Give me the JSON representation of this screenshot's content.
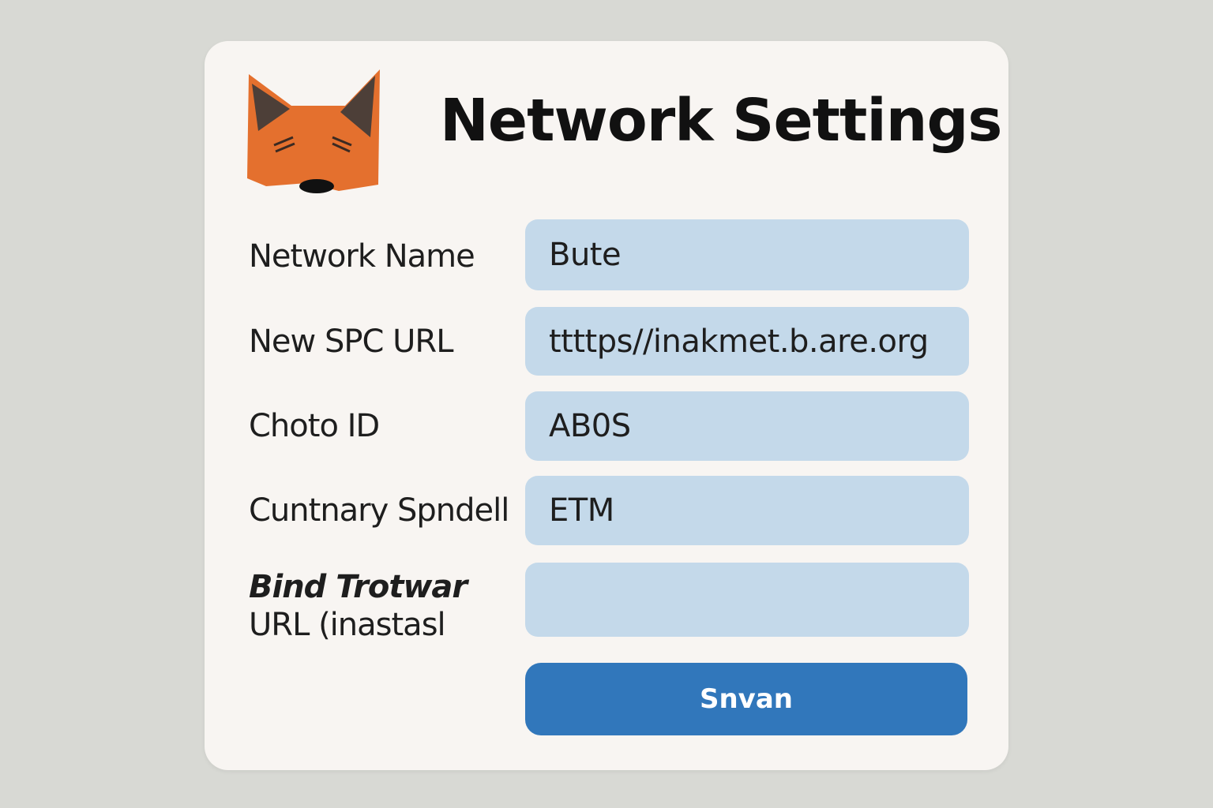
{
  "header": {
    "title": "Network Settings",
    "logo_icon": "fox-icon"
  },
  "form": {
    "fields": [
      {
        "label": "Network Name",
        "value": "Bute"
      },
      {
        "label": "New SPC  URL",
        "value": "ttttps//inakmet.b.are.org"
      },
      {
        "label": "Choto ID",
        "value": "AB0S"
      },
      {
        "label": "Cuntnary Spndell",
        "value": "ETM"
      },
      {
        "label_line1": "Bind Trotwar",
        "label_line2": "URL (inastasl",
        "value": ""
      }
    ],
    "save_label": "Snvan"
  },
  "colors": {
    "background": "#d8d9d4",
    "card": "#f8f5f2",
    "field": "#c4d9ea",
    "button": "#3177bb",
    "fox_orange": "#e4702e"
  }
}
